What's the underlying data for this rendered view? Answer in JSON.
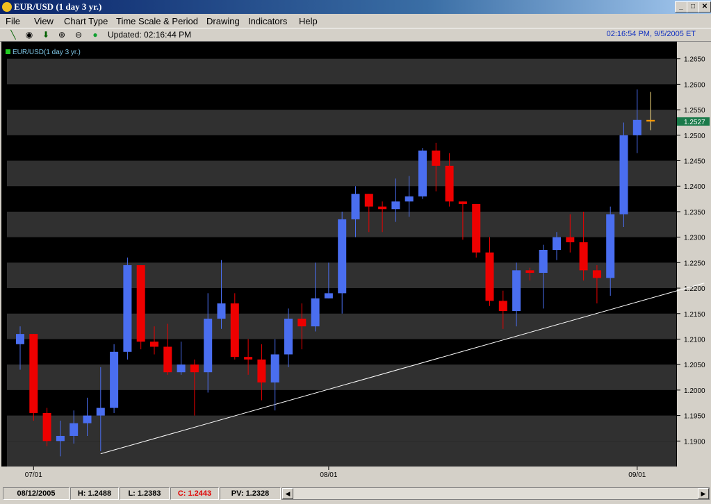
{
  "window": {
    "title": "EUR/USD (1 day  3 yr.)"
  },
  "menu": [
    "File",
    "View",
    "Chart Type",
    "Time Scale & Period",
    "Drawing",
    "Indicators",
    "Help"
  ],
  "toolbar": {
    "updated": "Updated: 02:16:44 PM",
    "clock": "02:16:54 PM, 9/5/2005 ET"
  },
  "status": {
    "date": "08/12/2005",
    "high": "H: 1.2488",
    "low": "L: 1.2383",
    "close": "C: 1.2443",
    "pv": "PV: 1.2328",
    "close_color": "#e00000"
  },
  "colors": {
    "up": "#4a6ef0",
    "down": "#ee0000",
    "last": "#ff9900",
    "price_tag": "#1a7a4a"
  },
  "chart_data": {
    "type": "candlestick",
    "legend": "EUR/USD(1 day  3 yr.)",
    "last_price": "1.2527",
    "ylim": [
      1.185,
      1.267
    ],
    "yticks": [
      "1.1900",
      "1.1950",
      "1.2000",
      "1.2050",
      "1.2100",
      "1.2150",
      "1.2200",
      "1.2250",
      "1.2300",
      "1.2350",
      "1.2400",
      "1.2450",
      "1.2500",
      "1.2550",
      "1.2600",
      "1.2650"
    ],
    "xticks": [
      {
        "label": "07/01",
        "index": 1
      },
      {
        "label": "08/01",
        "index": 23
      },
      {
        "label": "09/01",
        "index": 46
      }
    ],
    "ohlc": [
      [
        1.209,
        1.2125,
        1.204,
        1.211
      ],
      [
        1.211,
        1.211,
        1.194,
        1.1955
      ],
      [
        1.1955,
        1.1965,
        1.189,
        1.19
      ],
      [
        1.19,
        1.194,
        1.187,
        1.191
      ],
      [
        1.191,
        1.196,
        1.1895,
        1.1935
      ],
      [
        1.1935,
        1.1985,
        1.191,
        1.195
      ],
      [
        1.195,
        1.2045,
        1.188,
        1.1965
      ],
      [
        1.1965,
        1.209,
        1.1955,
        1.2075
      ],
      [
        1.2075,
        1.226,
        1.206,
        1.2245
      ],
      [
        1.2245,
        1.2245,
        1.208,
        1.2095
      ],
      [
        1.2095,
        1.2125,
        1.207,
        1.2085
      ],
      [
        1.2085,
        1.213,
        1.203,
        1.2035
      ],
      [
        1.2035,
        1.2095,
        1.203,
        1.205
      ],
      [
        1.205,
        1.206,
        1.195,
        1.2035
      ],
      [
        1.2035,
        1.219,
        1.1995,
        1.214
      ],
      [
        1.214,
        1.2255,
        1.212,
        1.217
      ],
      [
        1.217,
        1.219,
        1.206,
        1.2065
      ],
      [
        1.2065,
        1.21,
        1.203,
        1.206
      ],
      [
        1.206,
        1.209,
        1.198,
        1.2015
      ],
      [
        1.2015,
        1.21,
        1.196,
        1.207
      ],
      [
        1.207,
        1.216,
        1.2045,
        1.214
      ],
      [
        1.214,
        1.217,
        1.208,
        1.2125
      ],
      [
        1.2125,
        1.225,
        1.2115,
        1.218
      ],
      [
        1.218,
        1.225,
        1.218,
        1.219
      ],
      [
        1.219,
        1.235,
        1.215,
        1.2335
      ],
      [
        1.2335,
        1.24,
        1.23,
        1.2385
      ],
      [
        1.2385,
        1.2385,
        1.231,
        1.236
      ],
      [
        1.236,
        1.237,
        1.231,
        1.2355
      ],
      [
        1.2355,
        1.2415,
        1.233,
        1.237
      ],
      [
        1.237,
        1.242,
        1.234,
        1.238
      ],
      [
        1.238,
        1.2475,
        1.2375,
        1.247
      ],
      [
        1.247,
        1.2485,
        1.239,
        1.244
      ],
      [
        1.244,
        1.2465,
        1.236,
        1.237
      ],
      [
        1.237,
        1.237,
        1.2295,
        1.2365
      ],
      [
        1.2365,
        1.2365,
        1.226,
        1.227
      ],
      [
        1.227,
        1.23,
        1.2165,
        1.2175
      ],
      [
        1.2175,
        1.2195,
        1.212,
        1.2155
      ],
      [
        1.2155,
        1.225,
        1.2125,
        1.2235
      ],
      [
        1.2235,
        1.224,
        1.2215,
        1.223
      ],
      [
        1.223,
        1.2285,
        1.216,
        1.2275
      ],
      [
        1.2275,
        1.231,
        1.2255,
        1.23
      ],
      [
        1.23,
        1.2345,
        1.227,
        1.229
      ],
      [
        1.229,
        1.235,
        1.2215,
        1.2235
      ],
      [
        1.2235,
        1.2245,
        1.217,
        1.222
      ],
      [
        1.222,
        1.236,
        1.2185,
        1.2345
      ],
      [
        1.2345,
        1.2525,
        1.232,
        1.25
      ],
      [
        1.25,
        1.259,
        1.2465,
        1.253
      ],
      [
        1.253,
        1.2585,
        1.251,
        1.2527
      ]
    ],
    "trendline": [
      [
        6,
        1.1875
      ],
      [
        51,
        1.221
      ]
    ]
  }
}
